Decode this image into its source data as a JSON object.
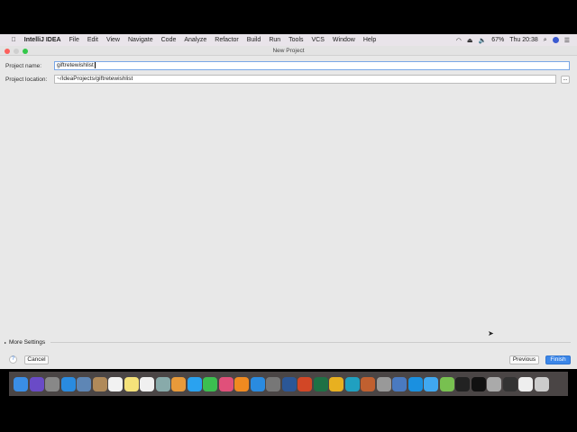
{
  "menubar": {
    "apple": "",
    "app": "IntelliJ IDEA",
    "items": [
      "File",
      "Edit",
      "View",
      "Navigate",
      "Code",
      "Analyze",
      "Refactor",
      "Build",
      "Run",
      "Tools",
      "VCS",
      "Window",
      "Help"
    ],
    "battery": "67%",
    "clock": "Thu 20:38"
  },
  "window": {
    "title": "New Project"
  },
  "form": {
    "name_label": "Project name:",
    "name_value": "giftretewishlist",
    "location_label": "Project location:",
    "location_value": "~/IdeaProjects/giftretewishlist",
    "browse": "..."
  },
  "more_settings": "More Settings",
  "buttons": {
    "help": "?",
    "cancel": "Cancel",
    "previous": "Previous",
    "finish": "Finish"
  },
  "accent": "#3b86e8",
  "dock": [
    {
      "name": "finder",
      "color": "#3a8ee6"
    },
    {
      "name": "siri",
      "color": "#6a4bc7"
    },
    {
      "name": "launchpad",
      "color": "#888"
    },
    {
      "name": "safari",
      "color": "#2a8be0"
    },
    {
      "name": "preview",
      "color": "#5e86b5"
    },
    {
      "name": "contacts",
      "color": "#b08a5a"
    },
    {
      "name": "calendar",
      "color": "#f2f2f2"
    },
    {
      "name": "notes",
      "color": "#f5e27a"
    },
    {
      "name": "reminders",
      "color": "#f0f0f0"
    },
    {
      "name": "photo-viewer",
      "color": "#8aa"
    },
    {
      "name": "photos",
      "color": "#e89a3a"
    },
    {
      "name": "messages",
      "color": "#2aa2f0"
    },
    {
      "name": "facetime",
      "color": "#3cbf50"
    },
    {
      "name": "itunes",
      "color": "#e0507a"
    },
    {
      "name": "ibooks",
      "color": "#f08a20"
    },
    {
      "name": "app-store",
      "color": "#2a8be0"
    },
    {
      "name": "system-preferences",
      "color": "#777"
    },
    {
      "name": "word",
      "color": "#2b5797"
    },
    {
      "name": "powerpoint",
      "color": "#d24726"
    },
    {
      "name": "excel",
      "color": "#1e7145"
    },
    {
      "name": "outlook",
      "color": "#e8b020"
    },
    {
      "name": "c-app",
      "color": "#20a0c0"
    },
    {
      "name": "keynote",
      "color": "#c06030"
    },
    {
      "name": "script-editor",
      "color": "#999"
    },
    {
      "name": "activity",
      "color": "#4a7ac0"
    },
    {
      "name": "skype",
      "color": "#1a90e0"
    },
    {
      "name": "skype-2",
      "color": "#40a8f0"
    },
    {
      "name": "android-studio",
      "color": "#78c050"
    },
    {
      "name": "intellij",
      "color": "#222"
    },
    {
      "name": "terminal",
      "color": "#111"
    },
    {
      "name": "disk-utility",
      "color": "#aaa"
    },
    {
      "name": "folder",
      "color": "#333"
    },
    {
      "name": "window",
      "color": "#eee"
    },
    {
      "name": "trash",
      "color": "#ccc"
    }
  ]
}
